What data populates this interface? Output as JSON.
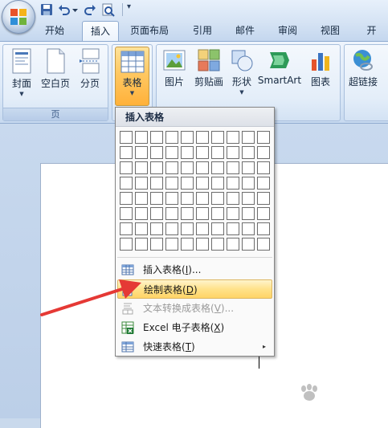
{
  "quick_access": {
    "items": [
      "save-icon",
      "undo-icon",
      "redo-icon",
      "print-preview-icon"
    ],
    "more": "▾"
  },
  "tabs": [
    {
      "label": "开始",
      "active": false
    },
    {
      "label": "插入",
      "active": true
    },
    {
      "label": "页面布局",
      "active": false
    },
    {
      "label": "引用",
      "active": false
    },
    {
      "label": "邮件",
      "active": false
    },
    {
      "label": "审阅",
      "active": false
    },
    {
      "label": "视图",
      "active": false
    },
    {
      "label": "开发工",
      "active": false
    }
  ],
  "ribbon": {
    "page_group": {
      "label": "页",
      "buttons": {
        "cover": "封面",
        "blank": "空白页",
        "break": "分页"
      }
    },
    "table_button": "表格",
    "illustration_buttons": {
      "picture": "图片",
      "clipart": "剪贴画",
      "shapes": "形状",
      "smartart": "SmartArt",
      "chart": "图表"
    },
    "hyperlink_button": "超链接"
  },
  "table_menu": {
    "header": "插入表格",
    "grid": {
      "columns": 10,
      "rows": 8
    },
    "items": [
      {
        "label": "插入表格",
        "key": "I",
        "suffix": "...",
        "enabled": true,
        "highlighted": false
      },
      {
        "label": "绘制表格",
        "key": "D",
        "suffix": "",
        "enabled": true,
        "highlighted": true
      },
      {
        "label": "文本转换成表格",
        "key": "V",
        "suffix": "...",
        "enabled": false,
        "highlighted": false
      },
      {
        "label": "Excel 电子表格",
        "key": "X",
        "suffix": "",
        "enabled": true,
        "highlighted": false
      },
      {
        "label": "快速表格",
        "key": "T",
        "suffix": "",
        "enabled": true,
        "highlighted": false,
        "submenu": "▸"
      }
    ]
  },
  "colors": {
    "annotation_arrow": "#e53935",
    "menu_highlight": "#ffd466",
    "ribbon_background": "#dbe8f7"
  }
}
